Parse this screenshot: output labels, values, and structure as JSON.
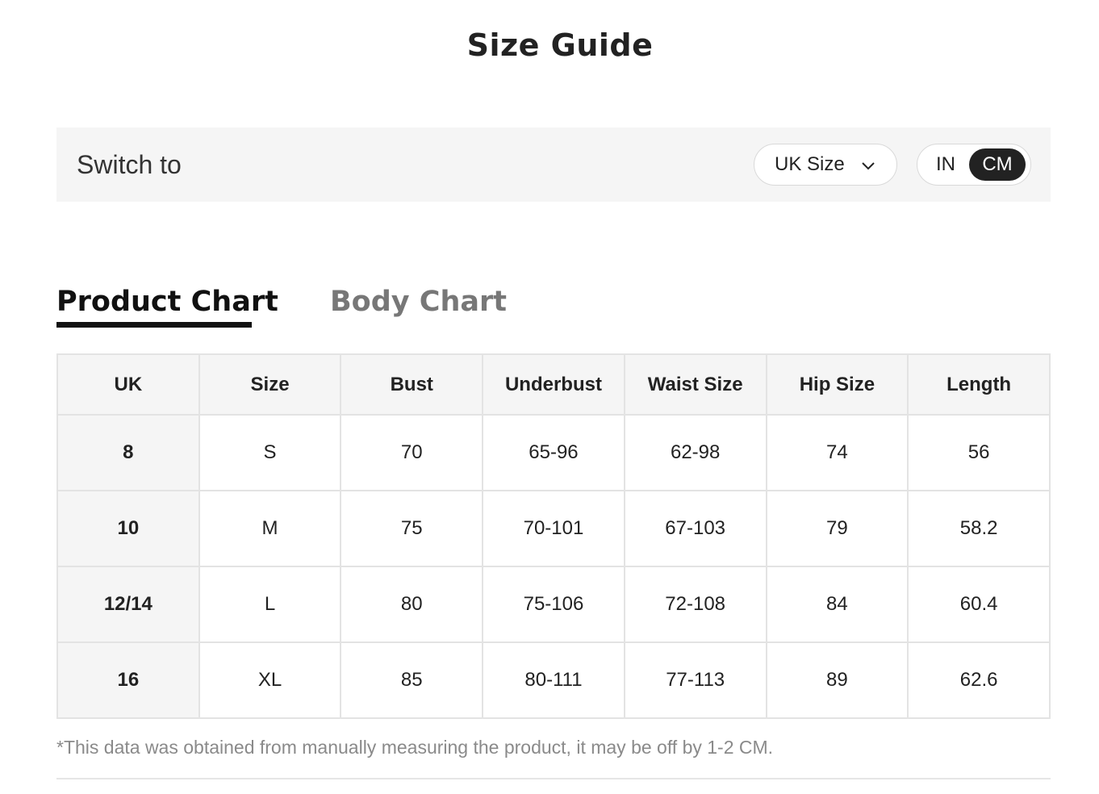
{
  "title": "Size Guide",
  "switch": {
    "label": "Switch to",
    "size_system": "UK Size",
    "units": [
      {
        "label": "IN",
        "selected": false
      },
      {
        "label": "CM",
        "selected": true
      }
    ]
  },
  "tabs": [
    {
      "label": "Product Chart",
      "active": true
    },
    {
      "label": "Body Chart",
      "active": false
    }
  ],
  "table": {
    "headers": [
      "UK",
      "Size",
      "Bust",
      "Underbust",
      "Waist Size",
      "Hip Size",
      "Length"
    ],
    "rows": [
      [
        "8",
        "S",
        "70",
        "65-96",
        "62-98",
        "74",
        "56"
      ],
      [
        "10",
        "M",
        "75",
        "70-101",
        "67-103",
        "79",
        "58.2"
      ],
      [
        "12/14",
        "L",
        "80",
        "75-106",
        "72-108",
        "84",
        "60.4"
      ],
      [
        "16",
        "XL",
        "85",
        "80-111",
        "77-113",
        "89",
        "62.6"
      ]
    ]
  },
  "note": "*This data was obtained from manually measuring the product, it may be off by 1-2 CM.",
  "colors": {
    "active": "#222222",
    "panel": "#f5f5f5",
    "muted": "#777777"
  }
}
